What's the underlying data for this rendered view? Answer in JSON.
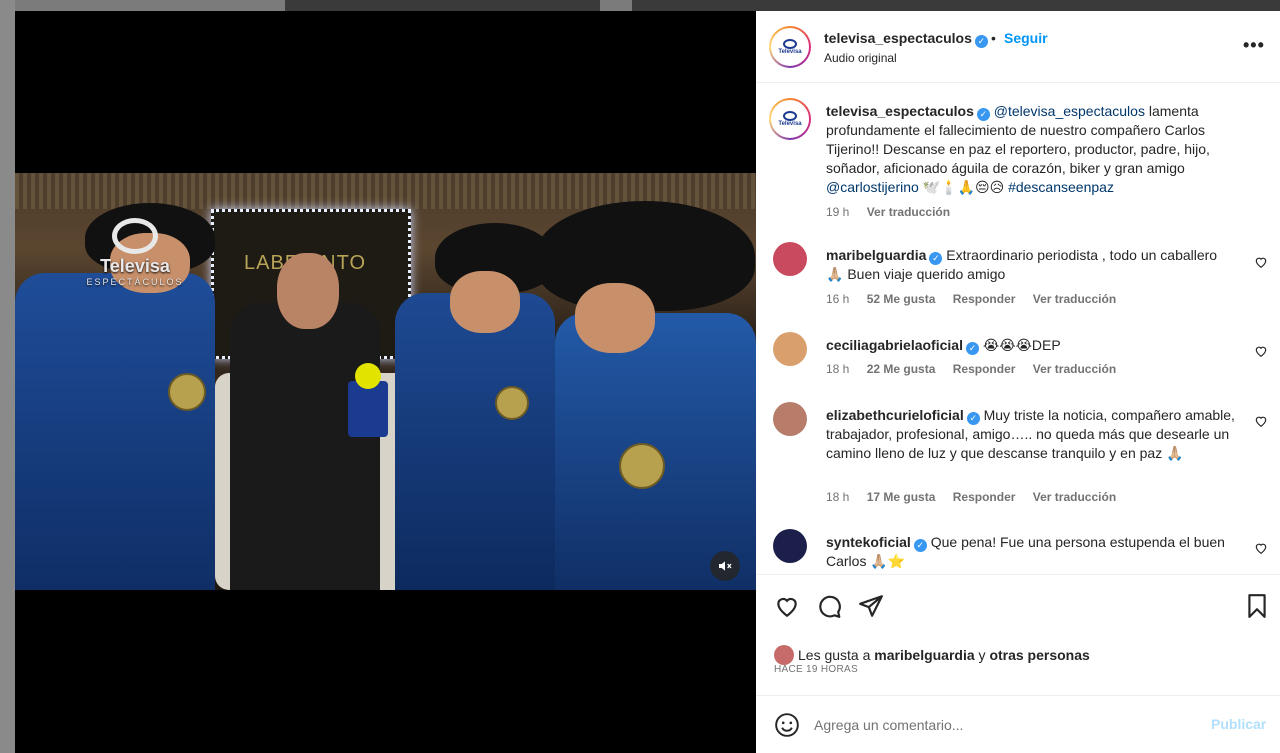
{
  "post": {
    "username": "televisa_espectaculos",
    "follow_label": "Seguir",
    "separator": "•",
    "audio": "Audio original",
    "more": "•••"
  },
  "video": {
    "brand": "Televisa",
    "brand_sub": "ESPECTÁCULOS",
    "neon_sign": "LABERINTO"
  },
  "caption": {
    "username": "televisa_espectaculos",
    "mention": "@televisa_espectaculos",
    "text": " lamenta profundamente el fallecimiento de nuestro compañero Carlos Tijerino!! Descanse en paz el reportero, productor, padre, hijo, soñador, aficionado águila de corazón, biker y gran amigo ",
    "mention2": "@carlostijerino",
    "emojis": " 🕊️🕯️🙏😔😥 ",
    "hashtag": "#descanseenpaz",
    "time": "19 h",
    "translate": "Ver traducción"
  },
  "comments": [
    {
      "username": "maribelguardia",
      "text": "Extraordinario periodista , todo un caballero 🙏🏼 Buen viaje querido amigo",
      "time": "16 h",
      "likes": "52 Me gusta",
      "reply": "Responder",
      "translate": "Ver traducción",
      "avatar_color": "#c94a5e"
    },
    {
      "username": "ceciliagabrielaoficial",
      "text": "😭😭😭DEP",
      "time": "18 h",
      "likes": "22 Me gusta",
      "reply": "Responder",
      "translate": "Ver traducción",
      "avatar_color": "#d9a06e"
    },
    {
      "username": "elizabethcurieloficial",
      "text": "Muy triste la noticia, compañero amable, trabajador, profesional, amigo….. no queda más que desearle un camino lleno de luz y que descanse tranquilo y en paz 🙏🏼",
      "time": "18 h",
      "likes": "17 Me gusta",
      "reply": "Responder",
      "translate": "Ver traducción",
      "avatar_color": "#b77c6a"
    },
    {
      "username": "syntekoficial",
      "text": "Que pena! Fue una persona estupenda el buen Carlos 🙏🏼⭐",
      "avatar_color": "#1c1f4a"
    }
  ],
  "likes_line": {
    "prefix": "Les gusta a ",
    "user": "maribelguardia",
    "middle": " y ",
    "others": "otras personas"
  },
  "time_ago": "HACE 19 HORAS",
  "compose": {
    "placeholder": "Agrega un comentario...",
    "publish": "Publicar"
  },
  "colors": {
    "accent": "#0095f6",
    "verified": "#3897f0",
    "publish_disabled": "#b2dffc"
  }
}
